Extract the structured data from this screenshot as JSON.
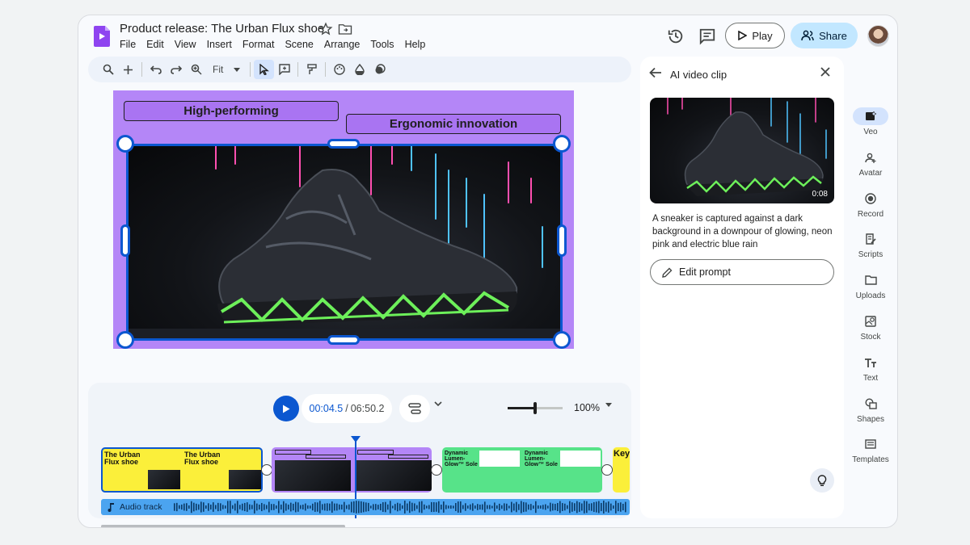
{
  "header": {
    "title": "Product release: The Urban Flux shoe",
    "menu": [
      "File",
      "Edit",
      "View",
      "Insert",
      "Format",
      "Scene",
      "Arrange",
      "Tools",
      "Help"
    ],
    "play_label": "Play",
    "share_label": "Share"
  },
  "toolbar": {
    "zoom_fit": "Fit"
  },
  "canvas": {
    "tag1": "High-performing",
    "tag2": "Ergonomic innovation"
  },
  "timeline": {
    "current_time": "00:04.5",
    "separator": "/",
    "total_time": "06:50.2",
    "zoom": "100%",
    "zoom_level": 0.47,
    "clips": [
      {
        "title_left": "The Urban Flux shoe",
        "title_right": "The Urban Flux shoe"
      },
      {
        "tag1": "High-performing",
        "tag2": "Ergonomic innovation"
      },
      {
        "title_left": "Dynamic Lumen-Glow™ Sole",
        "title_right": "Dynamic Lumen-Glow™ Sole"
      },
      {
        "title": "Key"
      }
    ],
    "audio_label": "Audio track"
  },
  "panel": {
    "title": "AI video clip",
    "video_duration": "0:08",
    "description": "A sneaker is captured against a dark background in a downpour of glowing, neon pink and electric blue rain",
    "edit_prompt": "Edit prompt"
  },
  "rail": {
    "items": [
      {
        "label": "Veo",
        "icon": "veo-icon",
        "active": true
      },
      {
        "label": "Avatar",
        "icon": "avatar-add-icon"
      },
      {
        "label": "Record",
        "icon": "record-icon"
      },
      {
        "label": "Scripts",
        "icon": "scripts-icon"
      },
      {
        "label": "Uploads",
        "icon": "folder-icon"
      },
      {
        "label": "Stock",
        "icon": "stock-icon"
      },
      {
        "label": "Text",
        "icon": "text-icon"
      },
      {
        "label": "Shapes",
        "icon": "shapes-icon"
      },
      {
        "label": "Templates",
        "icon": "templates-icon"
      }
    ]
  },
  "colors": {
    "accent": "#0b57d0",
    "share_bg": "#c2e7ff",
    "slide_purple": "#b486f7",
    "clip_yellow": "#fbef3a",
    "clip_green": "#57e389",
    "audio_blue": "#4ba4f0"
  }
}
